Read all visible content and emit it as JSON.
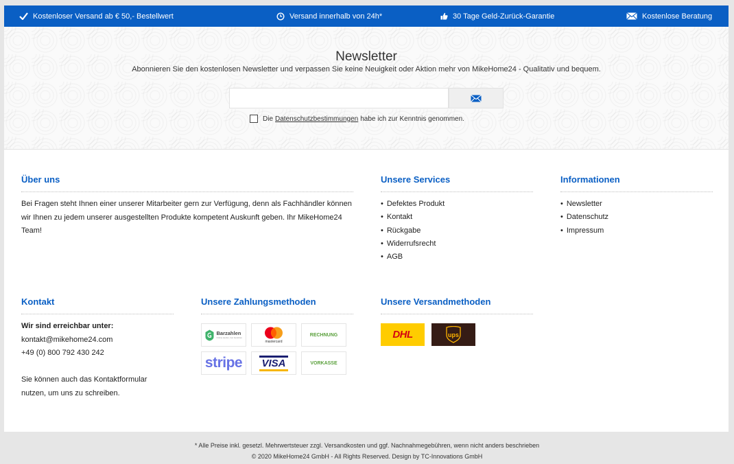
{
  "topbar": {
    "items": [
      {
        "icon": "checkmark-icon",
        "label": "Kostenloser Versand ab € 50,- Bestellwert"
      },
      {
        "icon": "clock-icon",
        "label": "Versand innerhalb von 24h*"
      },
      {
        "icon": "thumbs-up-icon",
        "label": "30 Tage Geld-Zurück-Garantie"
      },
      {
        "icon": "envelope-icon",
        "label": "Kostenlose Beratung"
      }
    ],
    "color": "#0a5fc4"
  },
  "newsletter": {
    "title": "Newsletter",
    "subtitle": "Abonnieren Sie den kostenlosen Newsletter und verpassen Sie keine Neuigkeit oder Aktion mehr von MikeHome24 - Qualitativ und bequem.",
    "email_value": "",
    "submit_icon": "envelope-icon",
    "consent_prefix": "Die",
    "consent_link": "Datenschutzbestimmungen",
    "consent_suffix": "habe ich zur Kenntnis genommen."
  },
  "about": {
    "heading": "Über uns",
    "text": "Bei Fragen steht Ihnen einer unserer Mitarbeiter gern zur Verfügung, denn als Fachhändler können wir Ihnen zu jedem unserer ausgestellten Produkte kompetent Auskunft geben. Ihr MikeHome24 Team!"
  },
  "services": {
    "heading": "Unsere Services",
    "items": [
      "Defektes Produkt",
      "Kontakt",
      "Rückgabe",
      "Widerrufsrecht",
      "AGB"
    ]
  },
  "info": {
    "heading": "Informationen",
    "items": [
      "Newsletter",
      "Datenschutz",
      "Impressum"
    ]
  },
  "contact": {
    "heading": "Kontakt",
    "reach_label": "Wir sind erreichbar unter:",
    "email": "kontakt@mikehome24.com",
    "phone": "+49 (0) 800 792 430 242",
    "form_note": "Sie können auch das Kontaktformular nutzen, um uns zu schreiben."
  },
  "payment": {
    "heading": "Unsere Zahlungsmethoden",
    "methods": {
      "barzahlen": "Barzahlen",
      "barzahlen_sub": "Online kaufen, bar bezahlen",
      "mastercard": "mastercard",
      "rechnung": "RECHNUNG",
      "stripe": "stripe",
      "visa": "VISA",
      "vorkasse": "VORKASSE"
    }
  },
  "shipping": {
    "heading": "Unsere Versandmethoden",
    "dhl": "DHL",
    "ups": "ups"
  },
  "footer": {
    "line1": "* Alle Preise inkl. gesetzl. Mehrwertsteuer zzgl. Versandkosten und ggf. Nachnahmegebühren, wenn nicht anders beschrieben",
    "line2": "© 2020 MikeHome24 GmbH - All Rights Reserved. Design by TC-Innovations GmbH"
  },
  "colors": {
    "accent": "#0a5fc4",
    "dhl_yellow": "#ffcc00",
    "dhl_red": "#d40511",
    "ups_brown": "#351c15",
    "ups_gold": "#ffb500"
  }
}
